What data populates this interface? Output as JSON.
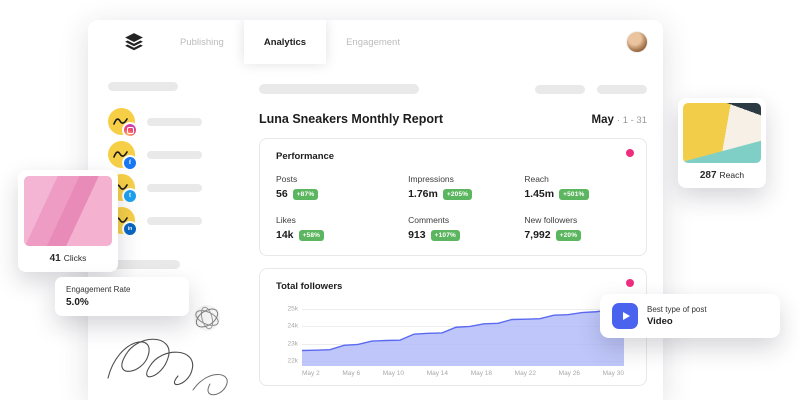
{
  "nav": {
    "tabs": [
      {
        "label": "Publishing"
      },
      {
        "label": "Analytics"
      },
      {
        "label": "Engagement"
      }
    ]
  },
  "sidebar": {
    "accounts": [
      {
        "network": "instagram"
      },
      {
        "network": "facebook"
      },
      {
        "network": "twitter"
      },
      {
        "network": "linkedin"
      }
    ]
  },
  "report": {
    "title": "Luna Sneakers Monthly Report",
    "month": "May",
    "range": "· 1 - 31"
  },
  "performance": {
    "title": "Performance",
    "metrics": [
      {
        "label": "Posts",
        "value": "56",
        "delta": "+87%"
      },
      {
        "label": "Impressions",
        "value": "1.76m",
        "delta": "+205%"
      },
      {
        "label": "Reach",
        "value": "1.45m",
        "delta": "+501%"
      },
      {
        "label": "Likes",
        "value": "14k",
        "delta": "+58%"
      },
      {
        "label": "Comments",
        "value": "913",
        "delta": "+107%"
      },
      {
        "label": "New followers",
        "value": "7,992",
        "delta": "+20%"
      }
    ]
  },
  "chart_data": {
    "type": "area",
    "title": "Total followers",
    "x": [
      "May 2",
      "May 6",
      "May 10",
      "May 14",
      "May 18",
      "May 22",
      "May 26",
      "May 30"
    ],
    "y_ticks": [
      "25k",
      "24k",
      "23k",
      "22k"
    ],
    "ylim": [
      21700,
      25300
    ],
    "values": [
      22600,
      22620,
      22650,
      22900,
      22950,
      23150,
      23180,
      23200,
      23550,
      23600,
      23620,
      23950,
      24000,
      24150,
      24180,
      24400,
      24420,
      24450,
      24650,
      24680,
      24800,
      24850,
      24950,
      25000
    ],
    "legend": "none",
    "grid": true
  },
  "floating": {
    "clicks": {
      "value": "41",
      "label": "Clicks"
    },
    "reach": {
      "value": "287",
      "label": "Reach"
    },
    "engagement": {
      "label": "Engagement Rate",
      "value": "5.0%"
    },
    "best_post": {
      "label": "Best type of post",
      "value": "Video"
    }
  },
  "icons": {
    "logo": "stacked-layers",
    "best_post": "video-play",
    "accent_dot": "pink-dot"
  },
  "colors": {
    "accent_pink": "#ef2d7e",
    "badge_green": "#5cb65f",
    "brand_yellow": "#f7cf47",
    "chart_fill": "#aab4f8",
    "chart_stroke": "#5b6af0",
    "facebook_blue": "#1877f2",
    "twitter_blue": "#1da1f2",
    "linkedin_blue": "#0a66c2",
    "best_post_blue": "#4a63ee"
  }
}
